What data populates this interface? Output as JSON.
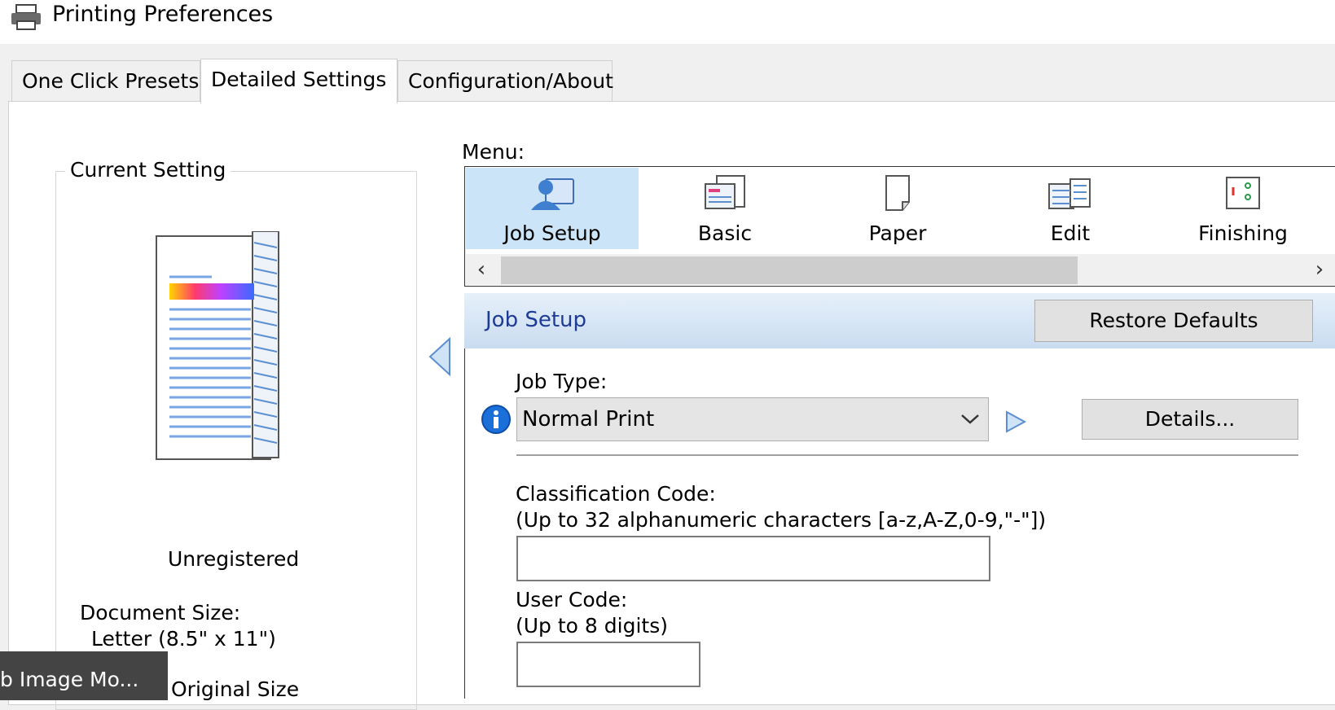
{
  "window": {
    "title": "Printing Preferences",
    "icon": "printer-icon"
  },
  "tabs": [
    {
      "label": "One Click Presets",
      "active": false
    },
    {
      "label": "Detailed Settings",
      "active": true
    },
    {
      "label": "Configuration/About",
      "active": false
    }
  ],
  "current_setting": {
    "group_label": "Current Setting",
    "status": "Unregistered",
    "document_size_label": "Document Size:",
    "document_size_value": "Letter (8.5\" x 11\")",
    "partial_text": "Original Size"
  },
  "taskbar_tooltip": "b Image Mo...",
  "menu": {
    "label": "Menu:",
    "items": [
      {
        "label": "Job Setup",
        "icon": "job-setup-icon",
        "selected": true
      },
      {
        "label": "Basic",
        "icon": "basic-icon",
        "selected": false
      },
      {
        "label": "Paper",
        "icon": "paper-icon",
        "selected": false
      },
      {
        "label": "Edit",
        "icon": "edit-icon",
        "selected": false
      },
      {
        "label": "Finishing",
        "icon": "finishing-icon",
        "selected": false
      }
    ]
  },
  "section": {
    "title": "Job Setup",
    "restore_label": "Restore Defaults"
  },
  "job_type": {
    "label": "Job Type:",
    "value": "Normal Print",
    "details_label": "Details..."
  },
  "classification": {
    "label": "Classification Code:",
    "hint": "(Up to 32 alphanumeric characters [a-z,A-Z,0-9,\"-\"])",
    "value": ""
  },
  "user_code": {
    "label": "User Code:",
    "hint": "(Up to 8 digits)",
    "value": ""
  },
  "colors": {
    "selection": "#cce4f7",
    "header_title": "#1e3c96",
    "info_blue": "#1a6fd8"
  }
}
